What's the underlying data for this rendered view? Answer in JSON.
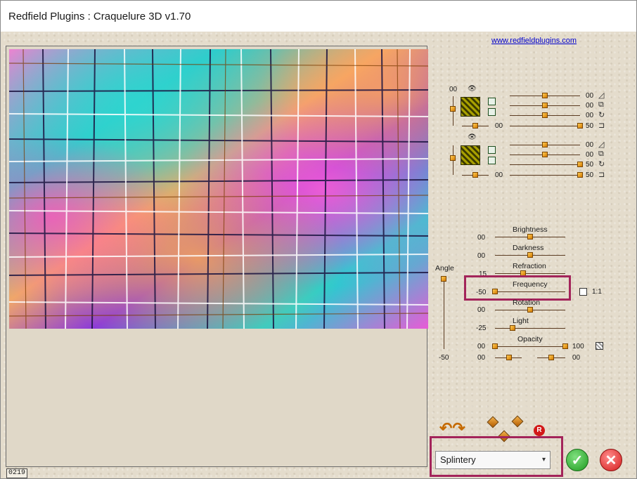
{
  "window": {
    "title": "Redfield Plugins : Craquelure 3D  v1.70"
  },
  "link": "www.redfieldplugins.com",
  "counter": "0219",
  "layer1": {
    "top": "00",
    "row1": "00",
    "row2": "00",
    "row3": "00",
    "row4_left": "00",
    "row4_right": "50"
  },
  "layer2": {
    "row1": "00",
    "row2": "00",
    "row3": "50",
    "row4_left": "00",
    "row4_right": "50"
  },
  "params": {
    "brightness": {
      "label": "Brightness",
      "value": "00"
    },
    "darkness": {
      "label": "Darkness",
      "value": "00"
    },
    "refraction": {
      "label": "Refraction",
      "value": "15"
    },
    "frequency": {
      "label": "Frequency",
      "value": "-50"
    },
    "rotation": {
      "label": "Rotation",
      "value": "00"
    },
    "light": {
      "label": "Light",
      "value": "-25"
    },
    "opacity": {
      "label": "Opacity",
      "value_left": "00",
      "value_right": "100"
    },
    "last_row": {
      "value_left": "00",
      "value_right": "00"
    }
  },
  "angle": {
    "label": "Angle",
    "value": "-50"
  },
  "ratio_label": "1:1",
  "preset": {
    "selected": "Splintery"
  },
  "buttons": {
    "ok": "✓",
    "cancel": "✕"
  }
}
